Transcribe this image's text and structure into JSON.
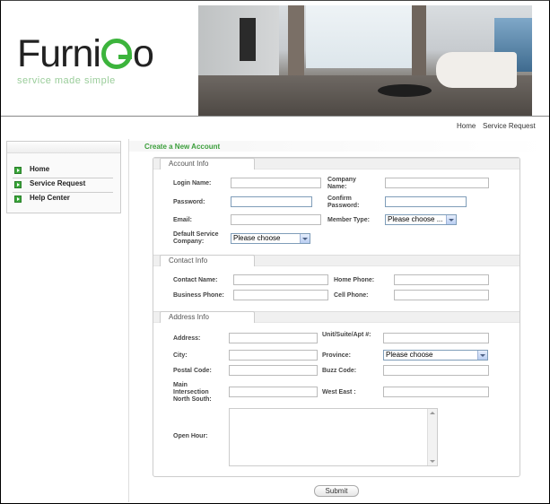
{
  "brand": {
    "name_part1": "Furni",
    "name_part2": "o",
    "tagline": "service made simple"
  },
  "top_nav": {
    "home": "Home",
    "service_request": "Service Request"
  },
  "sidebar": {
    "items": [
      {
        "label": "Home"
      },
      {
        "label": "Service Request"
      },
      {
        "label": "Help Center"
      }
    ]
  },
  "page": {
    "title": "Create a New Account",
    "submit_label": "Submit"
  },
  "account_info": {
    "section_title": "Account Info",
    "login_name": "Login Name:",
    "company_name": "Company Name:",
    "password": "Password:",
    "confirm_password": "Confirm Password:",
    "email": "Email:",
    "member_type": "Member Type:",
    "member_type_value": "Please choose ...",
    "default_service_company": "Default Service Company:",
    "default_service_company_value": "Please choose"
  },
  "contact_info": {
    "section_title": "Contact Info",
    "contact_name": "Contact Name:",
    "home_phone": "Home Phone:",
    "business_phone": "Business Phone:",
    "cell_phone": "Cell Phone:"
  },
  "address_info": {
    "section_title": "Address Info",
    "address": "Address:",
    "unit": "Unit/Suite/Apt #:",
    "city": "City:",
    "province": "Province:",
    "province_value": "Please choose",
    "postal_code": "Postal Code:",
    "buzz_code": "Buzz Code:",
    "main_intersection": "Main Intersection North South:",
    "west_east": "West East :",
    "open_hour": "Open Hour:"
  },
  "colors": {
    "accent_green": "#3b9e3b",
    "select_border": "#7f9db9"
  }
}
